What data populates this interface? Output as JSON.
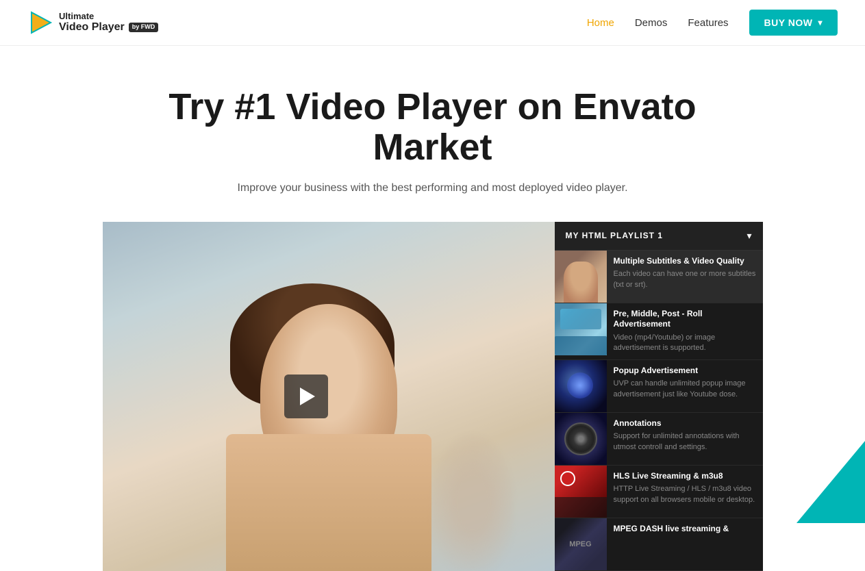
{
  "header": {
    "logo": {
      "ultimate": "Ultimate",
      "video_player": "Video Player",
      "by_fwd": "by FWD"
    },
    "nav": [
      {
        "label": "Home",
        "active": true
      },
      {
        "label": "Demos",
        "active": false
      },
      {
        "label": "Features",
        "active": false
      }
    ],
    "buy_button": "BUY NOW"
  },
  "hero": {
    "heading": "Try #1 Video Player on Envato Market",
    "subheading": "Improve your business with the best performing and most deployed video player."
  },
  "playlist": {
    "header": "MY HTML PLAYLIST 1",
    "items": [
      {
        "title": "Multiple Subtitles & Video Quality",
        "description": "Each video can have one or more subtitles (txt or srt).",
        "thumb_class": "thumb-1"
      },
      {
        "title": "Pre, Middle, Post - Roll Advertisement",
        "description": "Video (mp4/Youtube) or image advertisement is supported.",
        "thumb_class": "thumb-2"
      },
      {
        "title": "Popup Advertisement",
        "description": "UVP can handle unlimited popup image advertisement just like Youtube dose.",
        "thumb_class": "thumb-3"
      },
      {
        "title": "Annotations",
        "description": "Support for unlimited annotations with utmost controll and settings.",
        "thumb_class": "thumb-4"
      },
      {
        "title": "HLS Live Streaming & m3u8",
        "description": "HTTP Live Streaming / HLS / m3u8 video support on all browsers mobile or desktop.",
        "thumb_class": "thumb-5"
      },
      {
        "title": "MPEG DASH live streaming &",
        "description": "",
        "thumb_class": "thumb-6"
      }
    ]
  },
  "colors": {
    "accent_teal": "#00b5b5",
    "accent_orange": "#f0a500",
    "dark_bg": "#1a1a1a",
    "text_dark": "#1a1a1a",
    "text_muted": "#555555"
  }
}
